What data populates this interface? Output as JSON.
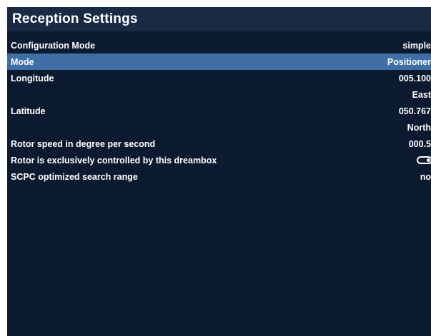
{
  "window": {
    "title": "Reception Settings"
  },
  "settings": [
    {
      "label": "Configuration Mode",
      "value": "simple",
      "selected": false
    },
    {
      "label": "Mode",
      "value": "Positioner",
      "selected": true
    },
    {
      "label": "Longitude",
      "value": "005.100",
      "selected": false
    },
    {
      "label": "",
      "value": "East",
      "selected": false
    },
    {
      "label": "Latitude",
      "value": "050.767",
      "selected": false
    },
    {
      "label": "",
      "value": "North",
      "selected": false
    },
    {
      "label": "Rotor speed in degree per second",
      "value": "000.5",
      "selected": false
    },
    {
      "label": "Rotor is exclusively controlled by this dreambox",
      "value": "",
      "toggle": "on",
      "selected": false
    },
    {
      "label": "SCPC optimized search range",
      "value": "no",
      "selected": false
    }
  ],
  "colors": {
    "background": "#0b1a2f",
    "title_bar": "#1a2a44",
    "selection": "#3f6fa6",
    "text": "#ffffff"
  }
}
